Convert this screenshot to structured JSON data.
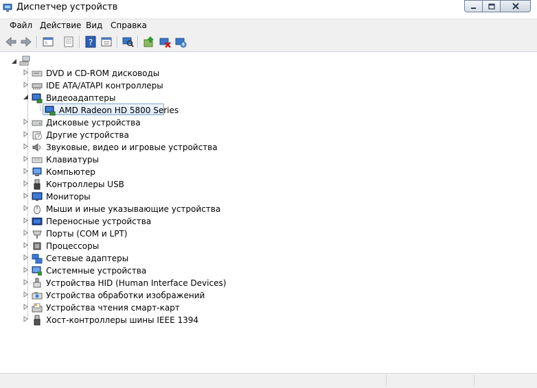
{
  "window": {
    "title": "Диспетчер устройств"
  },
  "menu": [
    "Файл",
    "Действие",
    "Вид",
    "Справка"
  ],
  "toolbar": [
    "back-icon",
    "forward-icon",
    "show-hide-tree-icon",
    "properties-icon",
    "help-icon",
    "console-tree-icon",
    "scan-hardware-icon",
    "update-driver-icon",
    "disable-device-icon",
    "uninstall-device-icon"
  ],
  "tree": {
    "categories": [
      {
        "label": "DVD и CD-ROM дисководы",
        "icon": "dvd-drive-icon"
      },
      {
        "label": "IDE ATA/ATAPI контроллеры",
        "icon": "ide-controller-icon"
      },
      {
        "label": "Видеоадаптеры",
        "icon": "display-adapter-icon",
        "expanded": true,
        "children": [
          {
            "label": "AMD Radeon HD 5800 Series",
            "icon": "display-adapter-icon",
            "selected": true
          }
        ]
      },
      {
        "label": "Дисковые устройства",
        "icon": "disk-drive-icon"
      },
      {
        "label": "Другие устройства",
        "icon": "unknown-device-icon"
      },
      {
        "label": "Звуковые, видео и игровые устройства",
        "icon": "speaker-icon"
      },
      {
        "label": "Клавиатуры",
        "icon": "keyboard-icon"
      },
      {
        "label": "Компьютер",
        "icon": "computer-icon"
      },
      {
        "label": "Контроллеры USB",
        "icon": "usb-icon"
      },
      {
        "label": "Мониторы",
        "icon": "monitor-icon"
      },
      {
        "label": "Мыши и иные указывающие устройства",
        "icon": "mouse-icon"
      },
      {
        "label": "Переносные устройства",
        "icon": "portable-device-icon"
      },
      {
        "label": "Порты (COM и LPT)",
        "icon": "port-icon"
      },
      {
        "label": "Процессоры",
        "icon": "processor-icon"
      },
      {
        "label": "Сетевые адаптеры",
        "icon": "network-adapter-icon"
      },
      {
        "label": "Системные устройства",
        "icon": "system-device-icon"
      },
      {
        "label": "Устройства HID (Human Interface Devices)",
        "icon": "hid-icon"
      },
      {
        "label": "Устройства обработки изображений",
        "icon": "imaging-device-icon"
      },
      {
        "label": "Устройства чтения смарт-карт",
        "icon": "smart-card-reader-icon"
      },
      {
        "label": "Хост-контроллеры шины IEEE 1394",
        "icon": "ieee1394-icon"
      }
    ]
  }
}
